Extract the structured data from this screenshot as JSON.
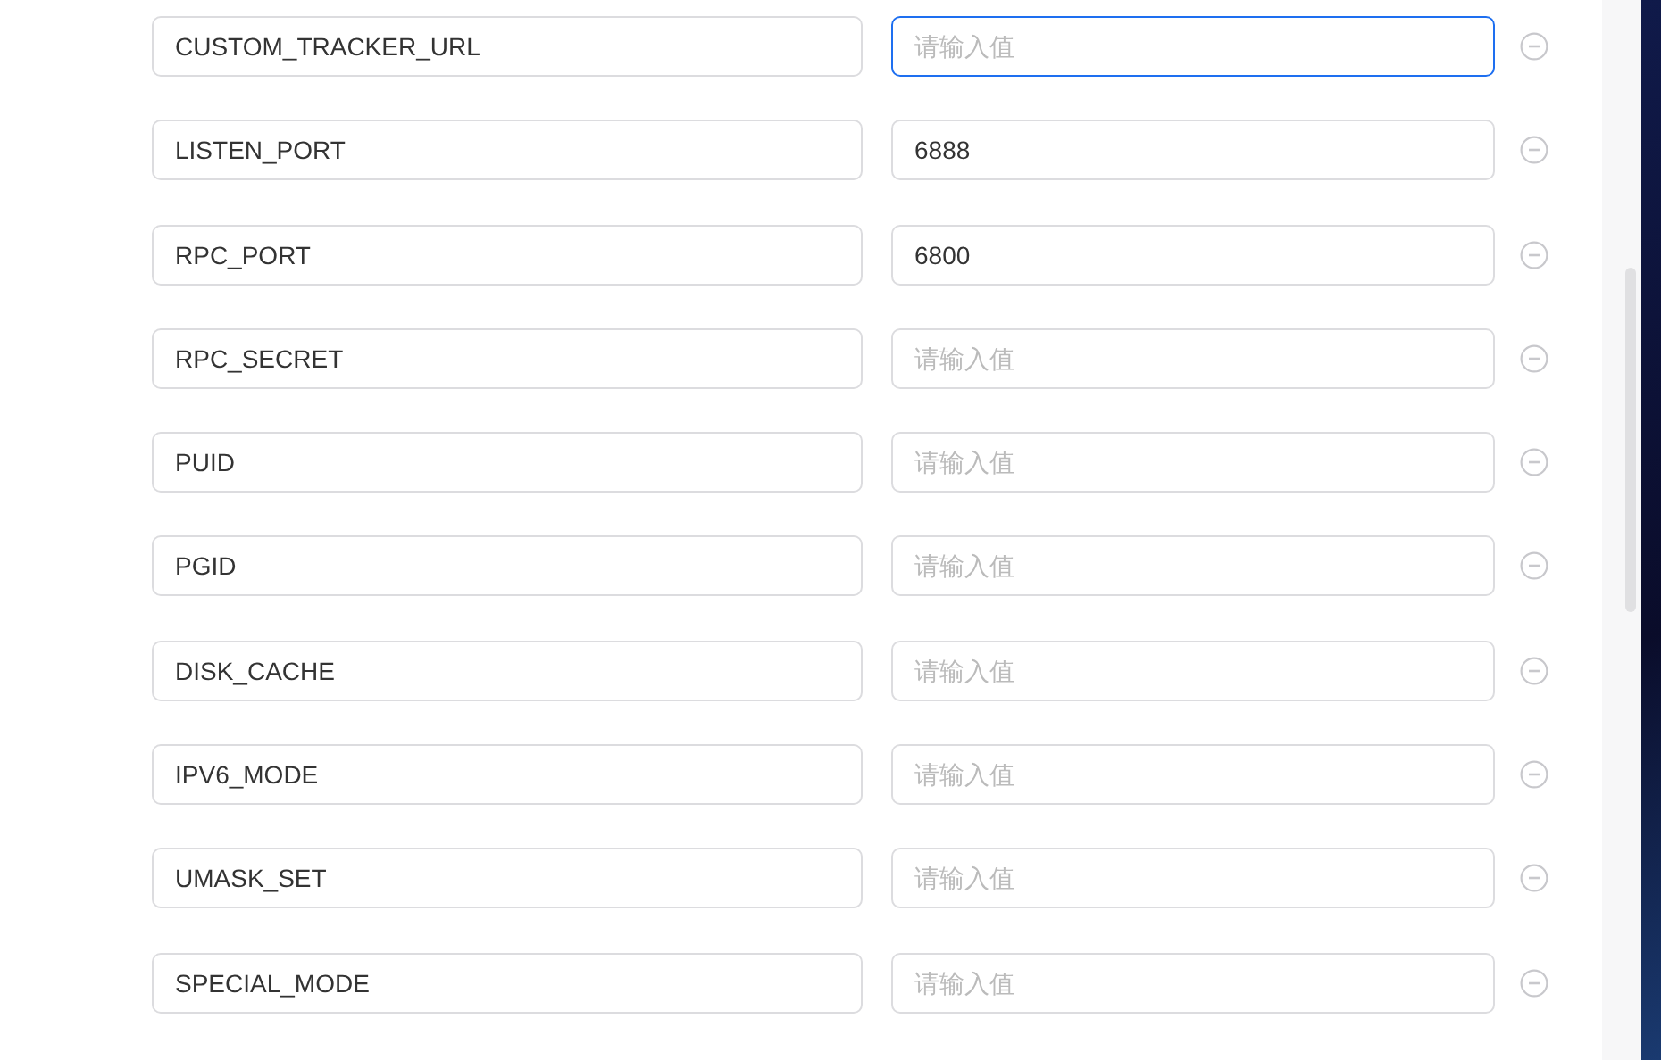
{
  "variables": [
    {
      "name": "CUSTOM_TRACKER_URL",
      "placeholder": "请输入值",
      "focused": true
    },
    {
      "name": "LISTEN_PORT",
      "value": "6888",
      "focused": false
    },
    {
      "name": "RPC_PORT",
      "value": "6800",
      "focused": false
    },
    {
      "name": "RPC_SECRET",
      "placeholder": "请输入值",
      "focused": false
    },
    {
      "name": "PUID",
      "placeholder": "请输入值",
      "focused": false
    },
    {
      "name": "PGID",
      "placeholder": "请输入值",
      "focused": false
    },
    {
      "name": "DISK_CACHE",
      "placeholder": "请输入值",
      "focused": false
    },
    {
      "name": "IPV6_MODE",
      "placeholder": "请输入值",
      "focused": false
    },
    {
      "name": "UMASK_SET",
      "placeholder": "请输入值",
      "focused": false
    },
    {
      "name": "SPECIAL_MODE",
      "placeholder": "请输入值",
      "focused": false
    }
  ]
}
